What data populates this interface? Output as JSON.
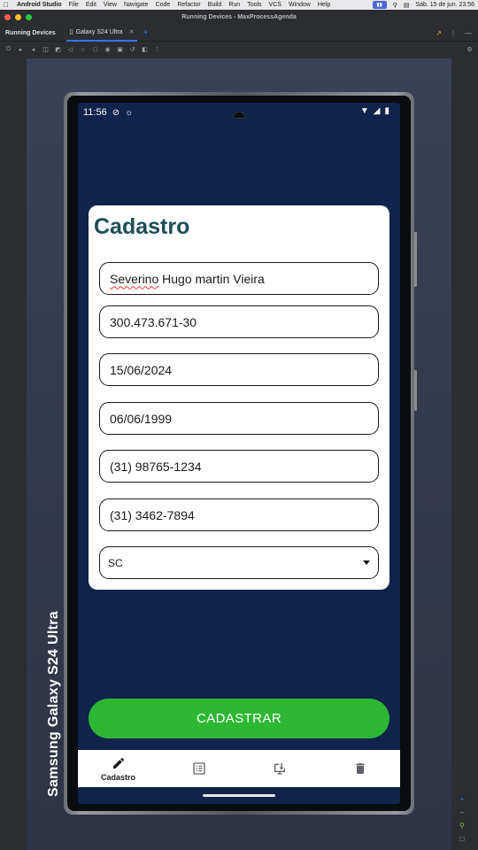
{
  "menubar": {
    "app_name": "Android Studio",
    "items": [
      "File",
      "Edit",
      "View",
      "Navigate",
      "Code",
      "Refactor",
      "Build",
      "Run",
      "Tools",
      "VCS",
      "Window",
      "Help"
    ],
    "clock": "Sáb. 15 de jun.  23:56"
  },
  "window": {
    "title": "Running Devices - MaxProcessAgenda"
  },
  "toolwindow": {
    "title": "Running Devices",
    "device_tab": "Galaxy S24 Ultra",
    "add_tab": "+"
  },
  "device": {
    "label": "Samsung Galaxy  S24 Ultra"
  },
  "phone": {
    "status_time": "11:56",
    "form": {
      "title": "Cadastro",
      "name_first": "Severino",
      "name_rest": " Hugo martin Vieira",
      "cpf": "300.473.671-30",
      "date1": "15/06/2024",
      "date2": "06/06/1999",
      "phone1": "(31) 98765-1234",
      "phone2": "(31) 3462-7894",
      "state": "SC"
    },
    "submit_label": "CADASTRAR",
    "nav": [
      {
        "label": "Cadastro",
        "icon": "pencil-icon"
      },
      {
        "label": "",
        "icon": "list-icon"
      },
      {
        "label": "",
        "icon": "download-icon"
      },
      {
        "label": "",
        "icon": "trash-icon"
      }
    ]
  },
  "colors": {
    "screen_bg": "#10234a",
    "title": "#1c4f57",
    "button": "#2db834",
    "accent": "#3574f0"
  }
}
